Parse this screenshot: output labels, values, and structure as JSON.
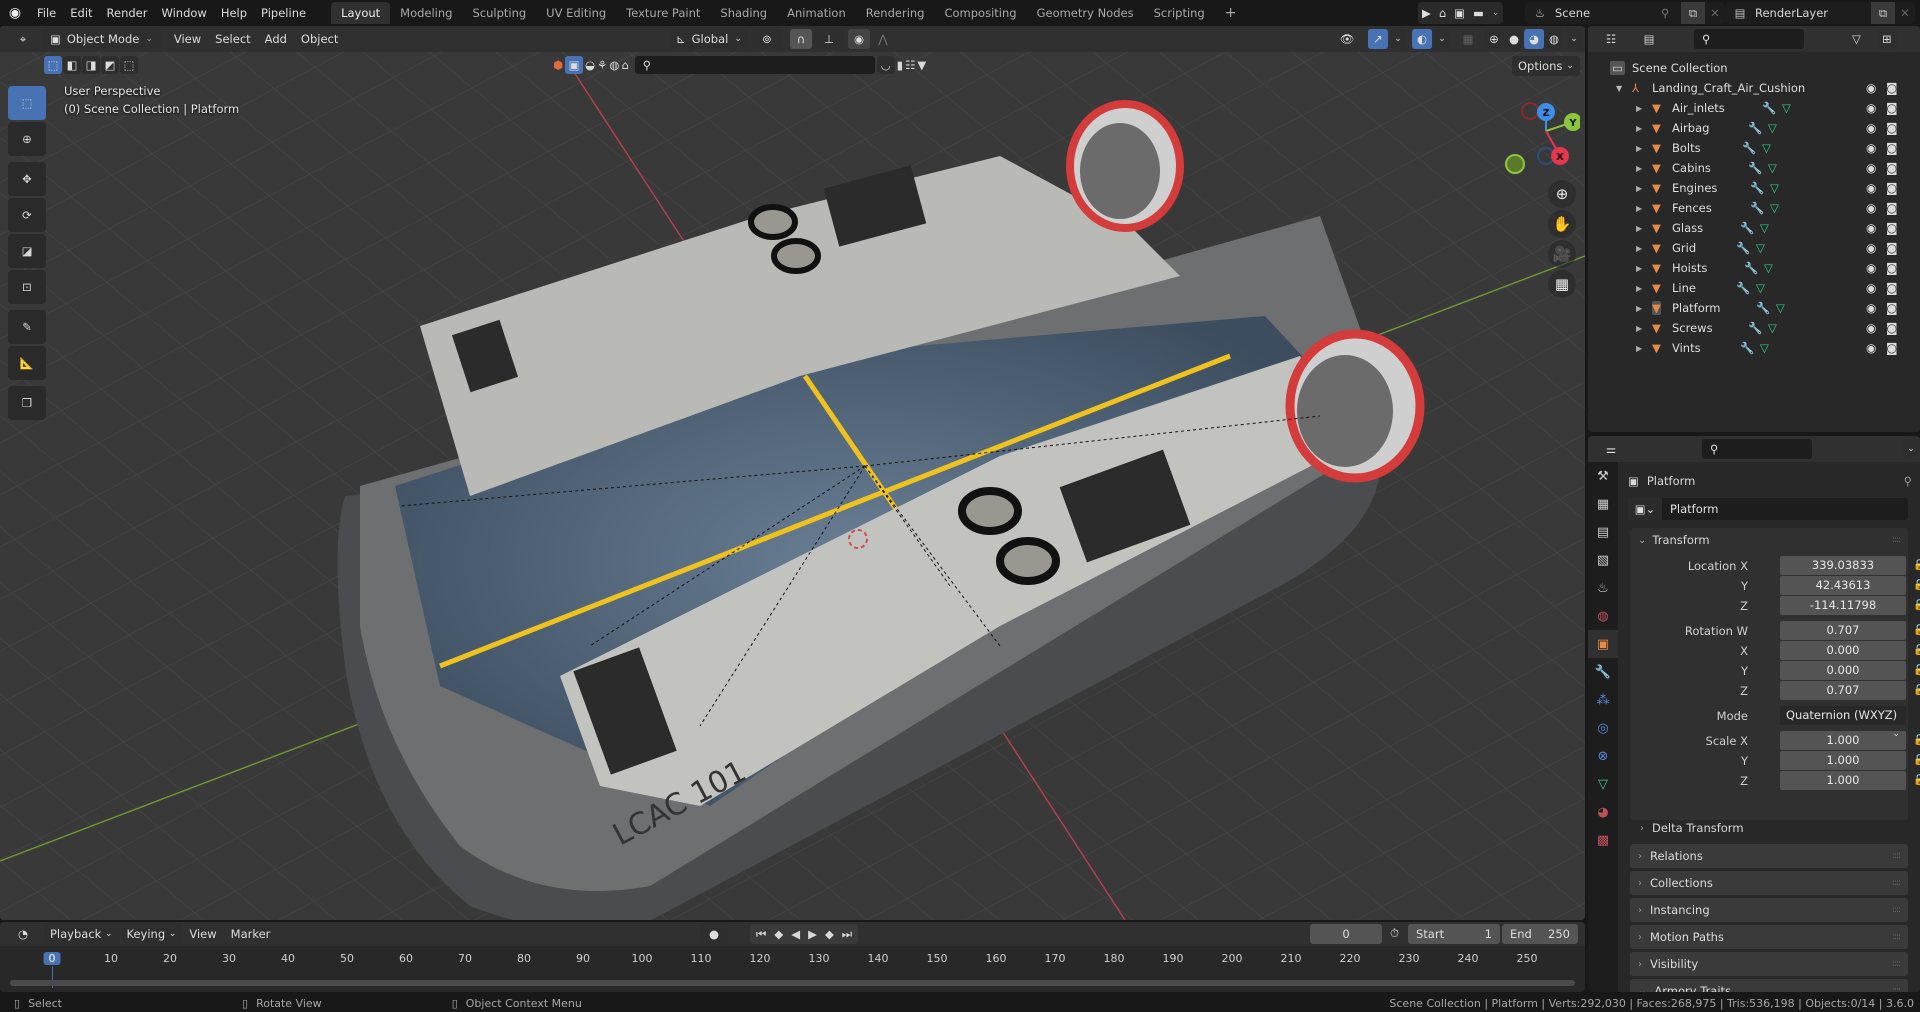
{
  "app_menu": [
    "File",
    "Edit",
    "Render",
    "Window",
    "Help",
    "Pipeline"
  ],
  "workspaces": [
    {
      "label": "Layout",
      "active": true
    },
    {
      "label": "Modeling"
    },
    {
      "label": "Sculpting"
    },
    {
      "label": "UV Editing"
    },
    {
      "label": "Texture Paint"
    },
    {
      "label": "Shading"
    },
    {
      "label": "Animation"
    },
    {
      "label": "Rendering"
    },
    {
      "label": "Compositing"
    },
    {
      "label": "Geometry Nodes"
    },
    {
      "label": "Scripting"
    }
  ],
  "add_workspace": "+",
  "scene": {
    "name": "Scene",
    "view_layer": "RenderLayer"
  },
  "viewport": {
    "mode": "Object Mode",
    "menus": [
      "View",
      "Select",
      "Add",
      "Object"
    ],
    "orientation": "Global",
    "options_label": "Options",
    "perspective_label": "User Perspective",
    "collection_label": "(0) Scene Collection | Platform",
    "axes": {
      "x": "X",
      "y": "Y",
      "z": "Z"
    }
  },
  "outliner": {
    "root": "Scene Collection",
    "collection": "Landing_Craft_Air_Cushion",
    "objects": [
      "Air_inlets",
      "Airbag",
      "Bolts",
      "Cabins",
      "Engines",
      "Fences",
      "Glass",
      "Grid",
      "Hoists",
      "Line",
      "Platform",
      "Screws",
      "Vints"
    ],
    "active_object": "Platform"
  },
  "properties": {
    "object_name": "Platform",
    "datablock_name": "Platform",
    "transform_label": "Transform",
    "location": {
      "label": "Location X",
      "x": "339.03833",
      "y": "42.43613",
      "z": "-114.11798"
    },
    "rotation": {
      "label": "Rotation W",
      "w": "0.707",
      "x": "0.000",
      "y": "0.000",
      "z": "0.707"
    },
    "mode_label": "Mode",
    "mode_value": "Quaternion (WXYZ)",
    "scale": {
      "label": "Scale X",
      "x": "1.000",
      "y": "1.000",
      "z": "1.000"
    },
    "axis_labels": {
      "x": "X",
      "y": "Y",
      "z": "Z"
    },
    "subpanels": [
      "Delta Transform"
    ],
    "panels": [
      "Relations",
      "Collections",
      "Instancing",
      "Motion Paths",
      "Visibility",
      "Armory Traits"
    ]
  },
  "timeline": {
    "menus": [
      "Playback",
      "Keying",
      "View",
      "Marker"
    ],
    "current_frame": "0",
    "start_label": "Start",
    "start": "1",
    "end_label": "End",
    "end": "250",
    "ticks": [
      "0",
      "10",
      "20",
      "30",
      "40",
      "50",
      "60",
      "70",
      "80",
      "90",
      "100",
      "110",
      "120",
      "130",
      "140",
      "150",
      "160",
      "170",
      "180",
      "190",
      "200",
      "210",
      "220",
      "230",
      "240",
      "250"
    ]
  },
  "statusbar": {
    "hints": [
      "Select",
      "Rotate View",
      "Object Context Menu"
    ],
    "info": "Scene Collection | Platform | Verts:292,030 | Faces:268,975 | Tris:536,198 | Objects:0/14 | 3.6.0"
  },
  "colors": {
    "accent": "#4772b3",
    "object_orange": "#e48b44",
    "axis_x": "#e5364f",
    "axis_y": "#8bc63c",
    "axis_z": "#3d8ee6",
    "deck_yellow": "#f0c21d"
  }
}
